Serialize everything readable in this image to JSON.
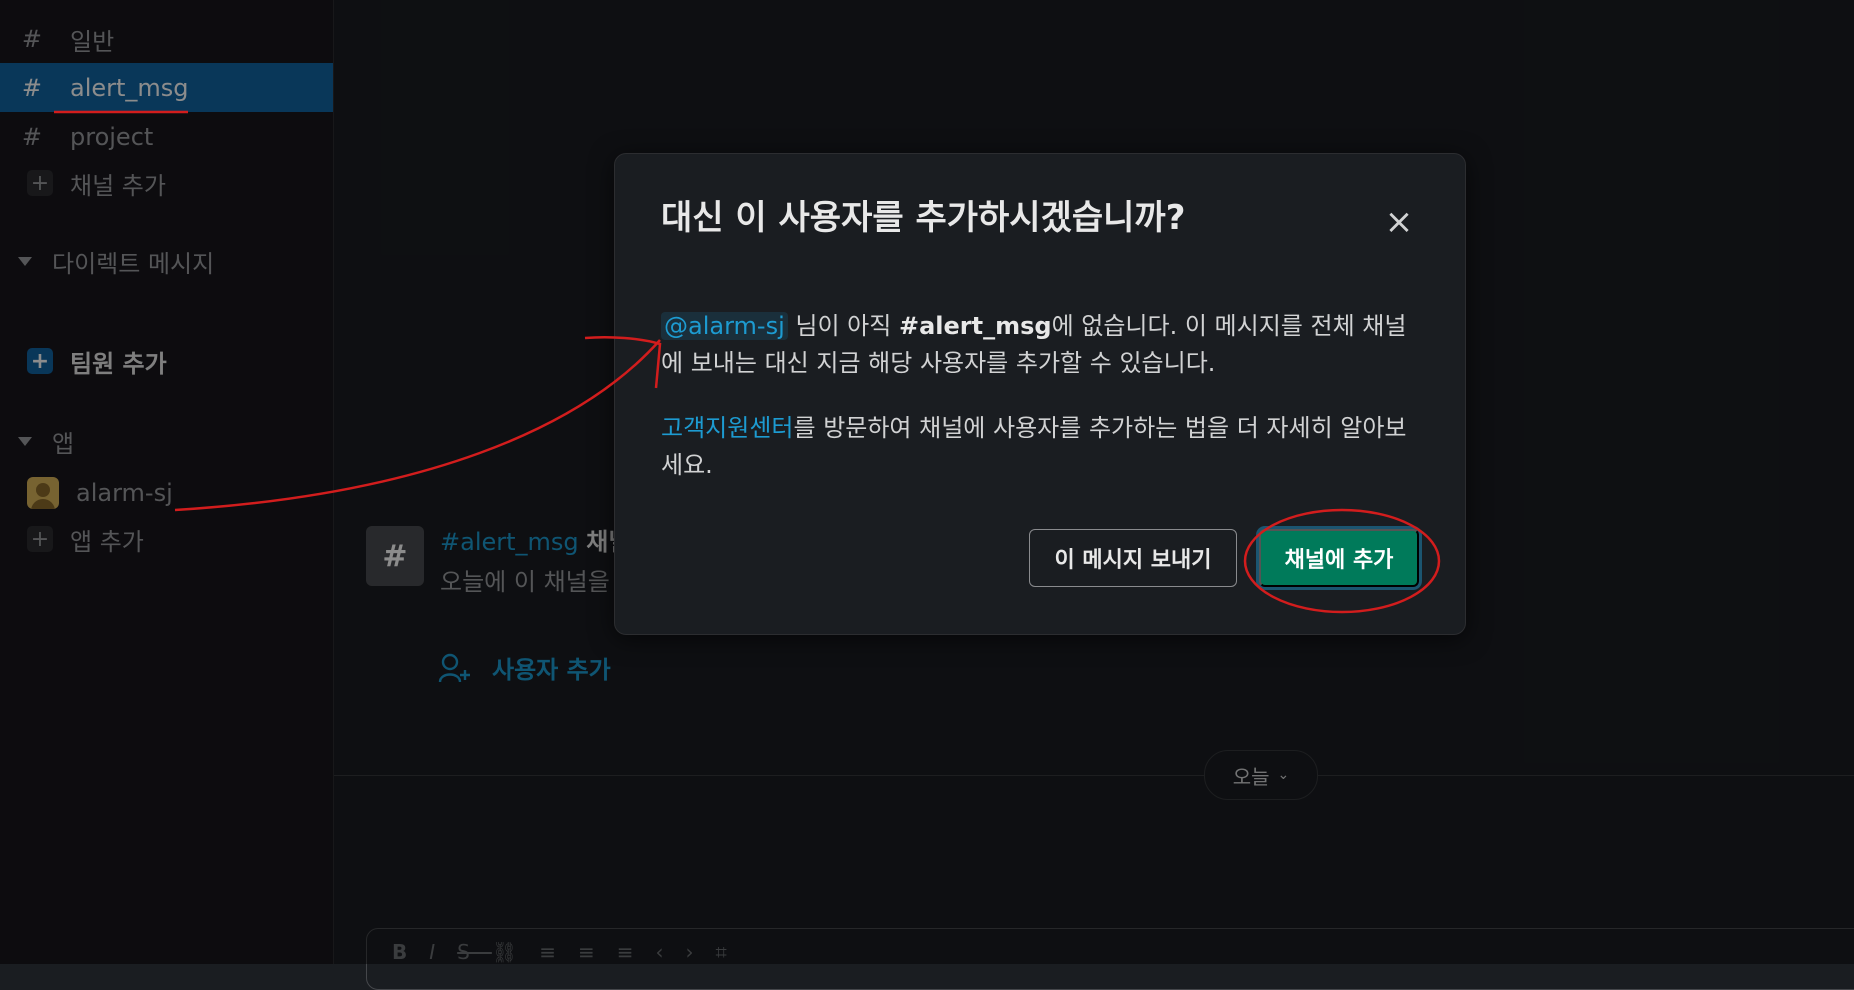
{
  "sidebar": {
    "channels": [
      {
        "label": "일반"
      },
      {
        "label": "alert_msg"
      },
      {
        "label": "project"
      }
    ],
    "add_channel": "채널 추가",
    "dm_section": "다이렉트 메시지",
    "add_member": "팀원 추가",
    "apps_section": "앱",
    "app_user": "alarm-sj",
    "add_app": "앱 추가"
  },
  "main": {
    "intro_channel": "#alert_msg",
    "intro_channel_suffix": "채널",
    "intro_sub": "오늘에 이 채널을",
    "add_user": "사용자 추가",
    "today": "오늘",
    "toolbar_icons": [
      "bold-icon",
      "italic-icon",
      "strike-icon",
      "link-icon",
      "ordered-list-icon",
      "bullet-list-icon",
      "indent-icon",
      "code-icon",
      "code-block-icon"
    ]
  },
  "modal": {
    "title": "대신 이 사용자를 추가하시겠습니까?",
    "mention": "@alarm-sj",
    "p1_a": " 님이 아직 ",
    "p1_channel": "#alert_msg",
    "p1_b": "에 없습니다. 이 메시지를 전체 채널에 보내는 대신 지금 해당 사용자를 추가할 수 있습니다.",
    "help_link": "고객지원센터",
    "p2": "를 방문하여 채널에 사용자를 추가하는 법을 더 자세히 알아보세요.",
    "send_button": "이 메시지 보내기",
    "add_button": "채널에 추가"
  },
  "colors": {
    "accent": "#1164a3",
    "primary_button": "#007a5a",
    "link": "#1d9bd1",
    "annotation": "#d21d1d"
  }
}
